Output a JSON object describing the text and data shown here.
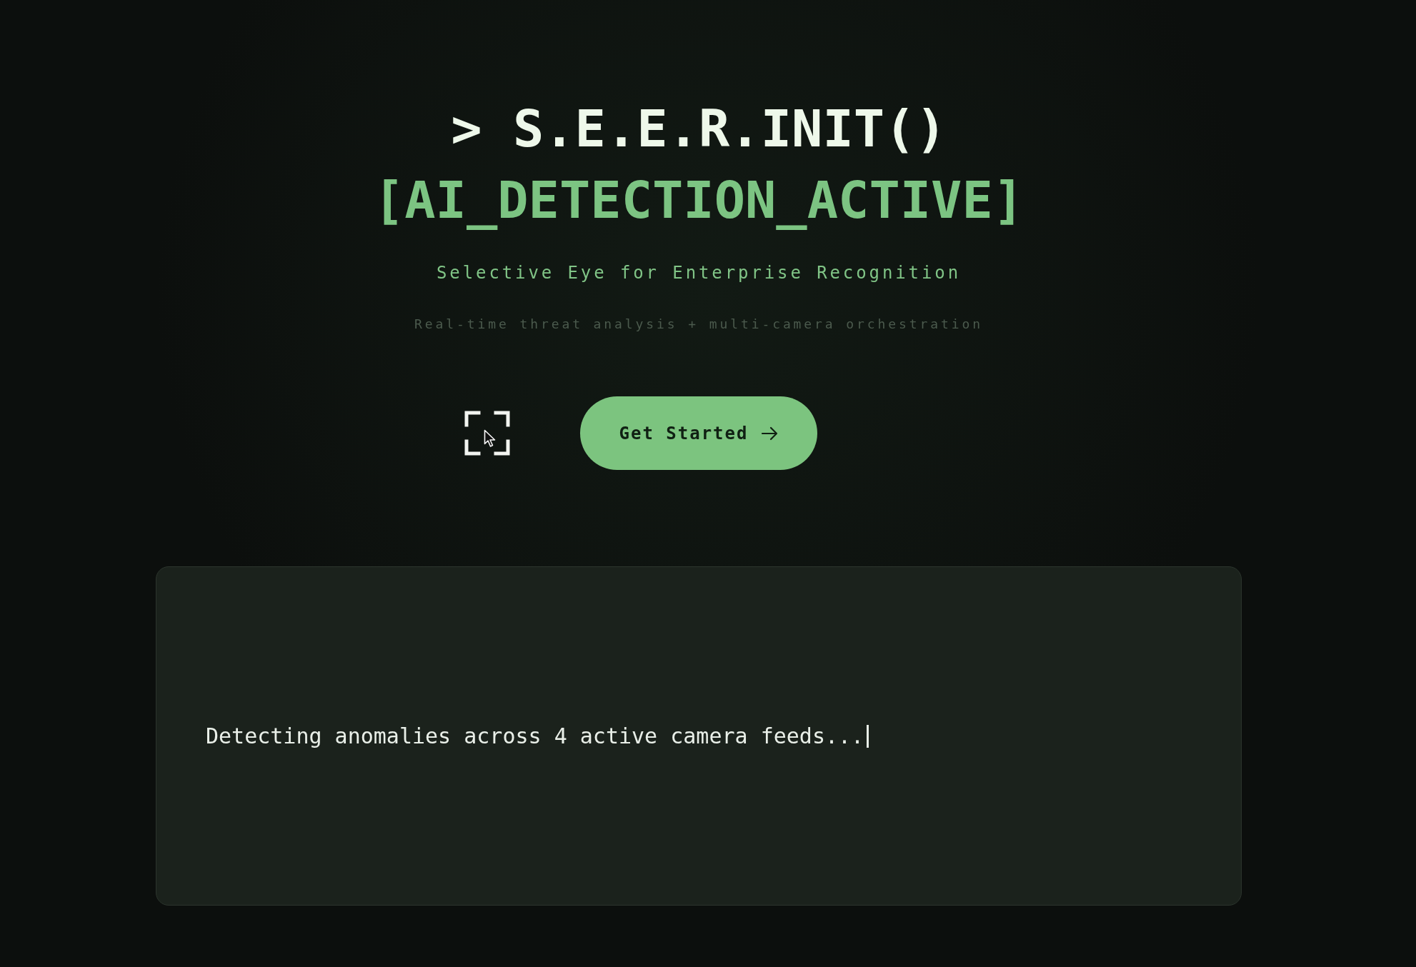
{
  "hero": {
    "title": "> S.E.E.R.INIT()",
    "status": "[AI_DETECTION_ACTIVE]",
    "subtitle": "Selective Eye for Enterprise Recognition",
    "tagline": "Real-time threat analysis + multi-camera orchestration"
  },
  "actions": {
    "cta": {
      "label": "Get Started"
    }
  },
  "terminal": {
    "text": "Detecting anomalies across 4 active camera feeds...",
    "caret": true
  }
}
